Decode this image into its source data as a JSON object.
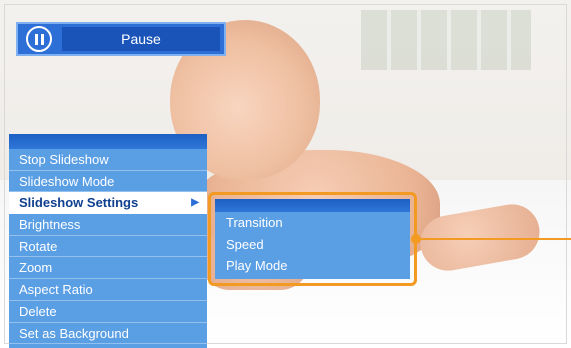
{
  "pause_bar": {
    "label": "Pause",
    "icon": "pause-icon"
  },
  "menu": {
    "items": [
      {
        "label": "Stop Slideshow"
      },
      {
        "label": "Slideshow Mode"
      },
      {
        "label": "Slideshow Settings",
        "selected": true,
        "icon": "arrow-right-icon",
        "arrow": "▶"
      },
      {
        "label": "Brightness"
      },
      {
        "label": "Rotate"
      },
      {
        "label": "Zoom"
      },
      {
        "label": "Aspect Ratio"
      },
      {
        "label": "Delete"
      },
      {
        "label": "Set as Background"
      }
    ]
  },
  "submenu": {
    "items": [
      {
        "label": "Transition"
      },
      {
        "label": "Speed"
      },
      {
        "label": "Play Mode"
      }
    ]
  },
  "colors": {
    "menu_bg": "#5a9ee4",
    "menu_header": "#1d5fc4",
    "highlight_border": "#f39a22",
    "pause_bg": "#2d6fd6"
  }
}
